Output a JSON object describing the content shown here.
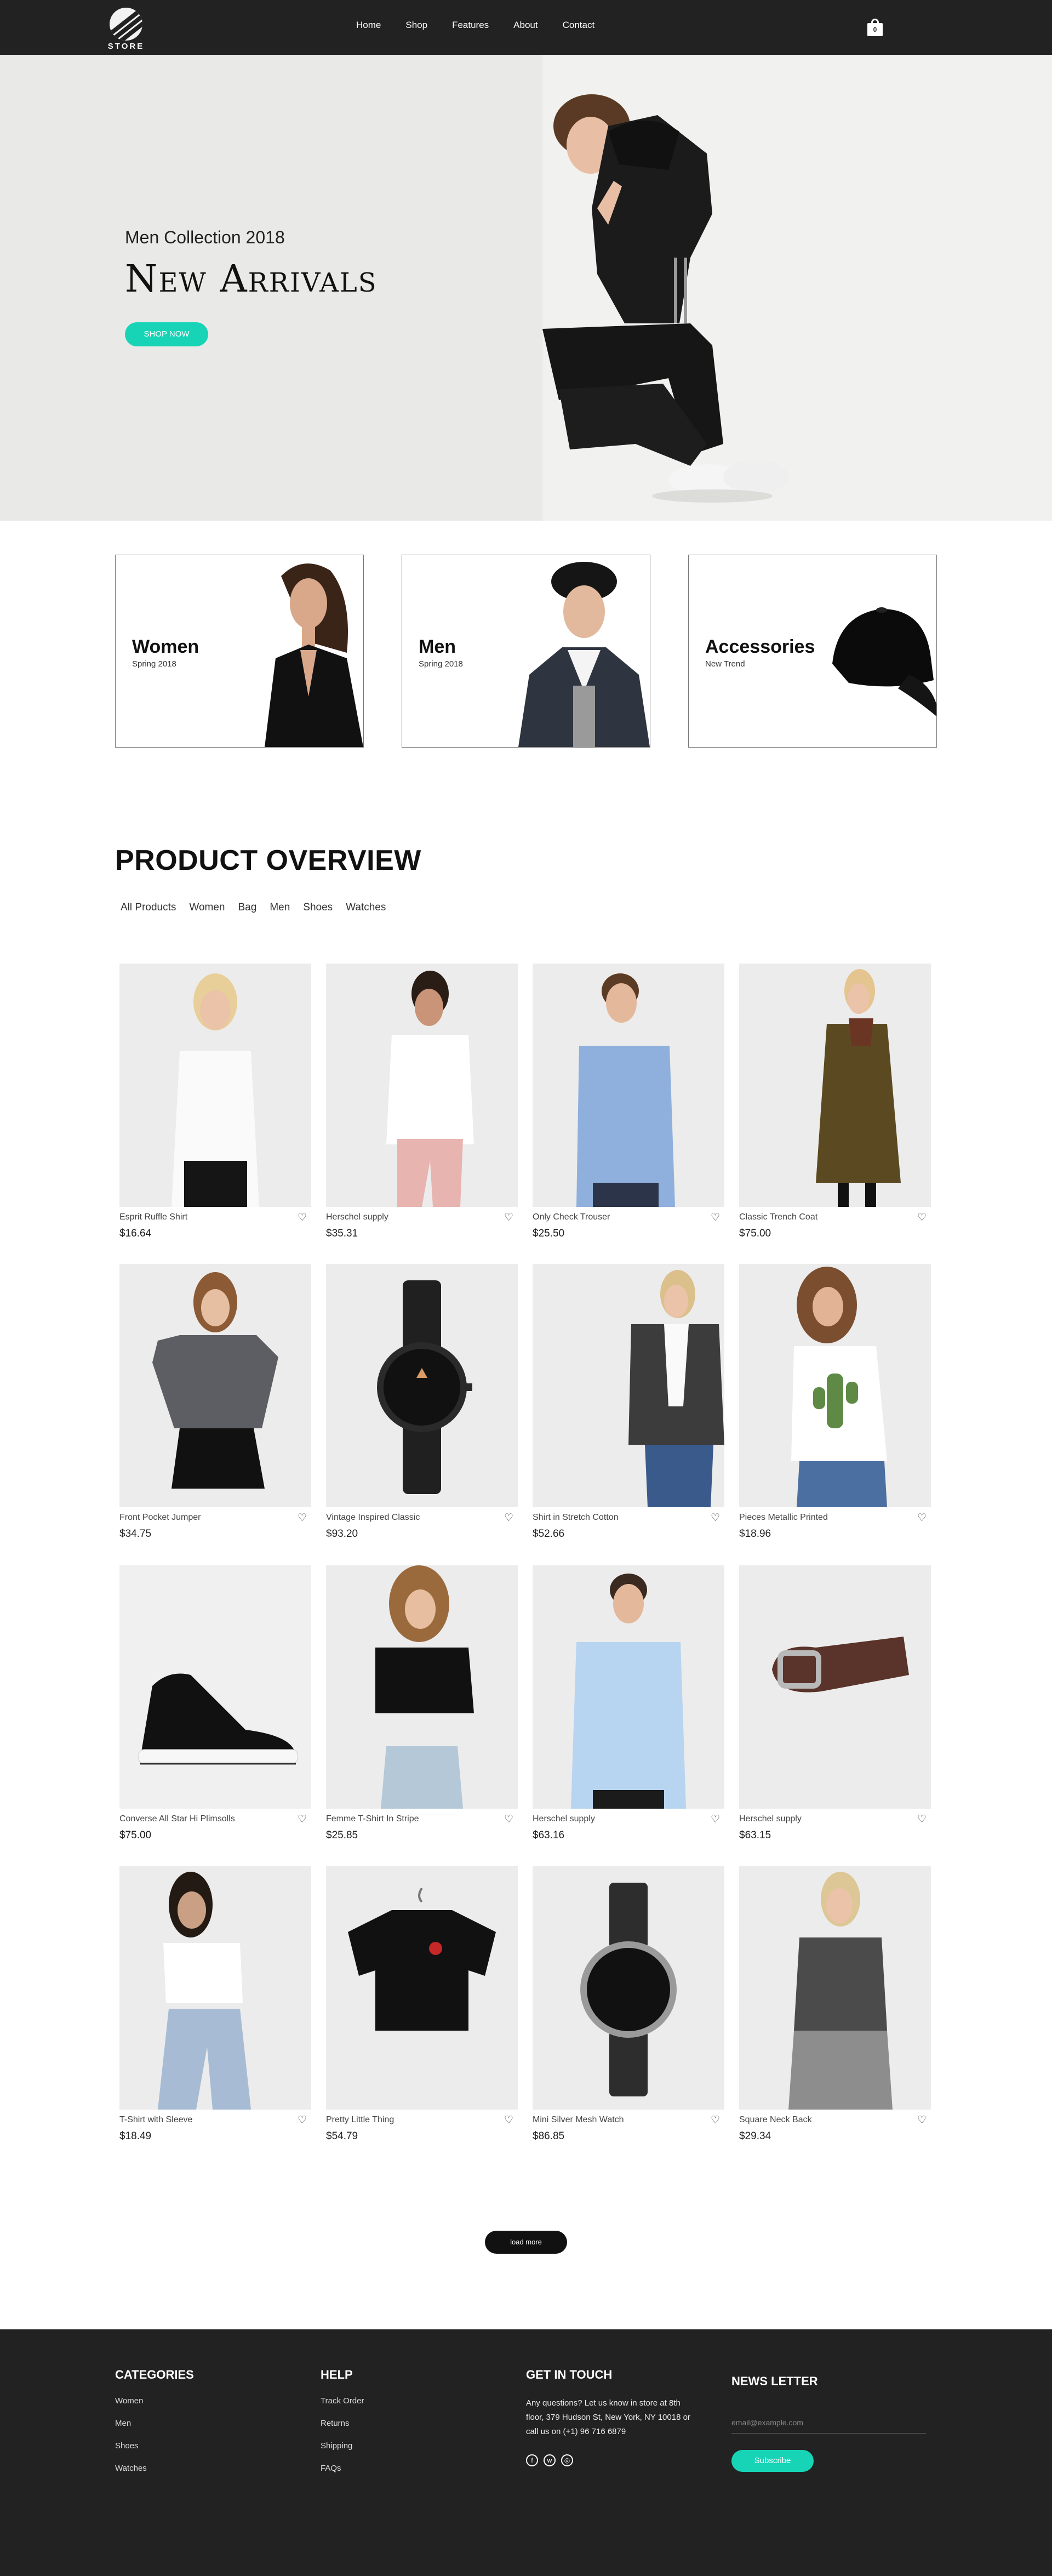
{
  "header": {
    "logo_text": "STORE",
    "nav": [
      "Home",
      "Shop",
      "Features",
      "About",
      "Contact"
    ],
    "cart_count": "0"
  },
  "hero": {
    "subtitle": "Men Collection 2018",
    "title": "New Arrivals",
    "cta": "SHOP NOW"
  },
  "banners": [
    {
      "title": "Women",
      "subtitle": "Spring 2018"
    },
    {
      "title": "Men",
      "subtitle": "Spring 2018"
    },
    {
      "title": "Accessories",
      "subtitle": "New Trend"
    }
  ],
  "overview": {
    "title": "PRODUCT OVERVIEW",
    "filters": [
      "All Products",
      "Women",
      "Bag",
      "Men",
      "Shoes",
      "Watches"
    ]
  },
  "products": [
    {
      "name": "Esprit Ruffle Shirt",
      "price": "$16.64"
    },
    {
      "name": "Herschel supply",
      "price": "$35.31"
    },
    {
      "name": "Only Check Trouser",
      "price": "$25.50"
    },
    {
      "name": "Classic Trench Coat",
      "price": "$75.00"
    },
    {
      "name": "Front Pocket Jumper",
      "price": "$34.75"
    },
    {
      "name": "Vintage Inspired Classic",
      "price": "$93.20"
    },
    {
      "name": "Shirt in Stretch Cotton",
      "price": "$52.66"
    },
    {
      "name": "Pieces Metallic Printed",
      "price": "$18.96"
    },
    {
      "name": "Converse All Star Hi Plimsolls",
      "price": "$75.00"
    },
    {
      "name": "Femme T-Shirt In Stripe",
      "price": "$25.85"
    },
    {
      "name": "Herschel supply",
      "price": "$63.16"
    },
    {
      "name": "Herschel supply",
      "price": "$63.15"
    },
    {
      "name": "T-Shirt with Sleeve",
      "price": "$18.49"
    },
    {
      "name": "Pretty Little Thing",
      "price": "$54.79"
    },
    {
      "name": "Mini Silver Mesh Watch",
      "price": "$86.85"
    },
    {
      "name": "Square Neck Back",
      "price": "$29.34"
    }
  ],
  "load_more": "load more",
  "footer": {
    "categories": {
      "title": "CATEGORIES",
      "links": [
        "Women",
        "Men",
        "Shoes",
        "Watches"
      ]
    },
    "help": {
      "title": "HELP",
      "links": [
        "Track Order",
        "Returns",
        "Shipping",
        "FAQs"
      ]
    },
    "contact": {
      "title": "GET IN TOUCH",
      "text": "Any questions? Let us know in store at 8th floor, 379 Hudson St, New York, NY 10018 or call us on (+1) 96 716 6879"
    },
    "newsletter": {
      "title": "NEWS LETTER",
      "placeholder": "email@example.com",
      "button": "Subscribe"
    }
  }
}
